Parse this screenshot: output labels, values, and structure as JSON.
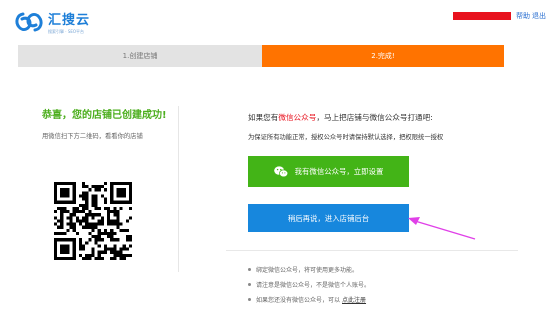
{
  "header": {
    "logo_name": "汇搜云",
    "logo_sub": "搜索引擎 · SEO平台",
    "help_label": "帮助",
    "logout_label": "退出"
  },
  "steps": [
    {
      "label": "1.创建店铺",
      "state": "done"
    },
    {
      "label": "2.完成!",
      "state": "active"
    }
  ],
  "left": {
    "title": "恭喜，您的店铺已创建成功!",
    "hint": "用微信扫下方二维码，看看你的店铺"
  },
  "right": {
    "title_prefix": "如果您有",
    "title_highlight": "微信公众号",
    "title_suffix": "，马上把店铺与微信公众号打通吧:",
    "desc": "为保证所有功能正常，授权公众号时请保持默认选择，把权限统一授权",
    "wechat_button": "我有微信公众号，立即设置",
    "later_button": "稍后再说，进入店铺后台"
  },
  "notes": [
    {
      "text": "绑定微信公众号，将可使用更多功能。"
    },
    {
      "text": "请注意是微信公众号，不是微信个人账号。"
    },
    {
      "text": "如果您还没有微信公众号，可以",
      "link": "点此注册"
    }
  ],
  "colors": {
    "brand": "#1e7fd8",
    "accent": "#ff7300",
    "success": "#4cae1d",
    "wechat": "#43b417",
    "primary": "#1787dd",
    "highlight": "#e8121e",
    "annotation_arrow": "#e040e8"
  },
  "icons": {
    "logo": "logo-mark-icon",
    "wechat": "wechat-icon",
    "qr": "qr-code"
  }
}
